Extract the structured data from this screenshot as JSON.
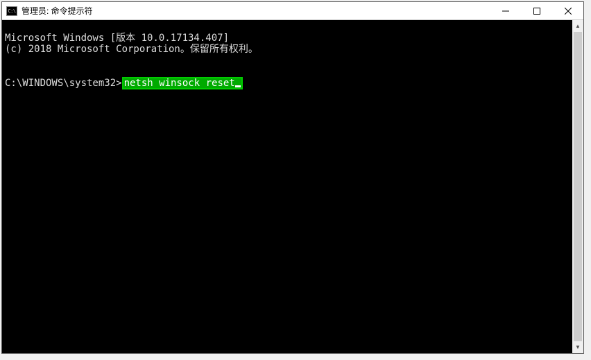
{
  "window": {
    "title": "管理员: 命令提示符",
    "icon_label": "C:\\"
  },
  "terminal": {
    "line1": "Microsoft Windows [版本 10.0.17134.407]",
    "line2": "(c) 2018 Microsoft Corporation。保留所有权利。",
    "prompt": "C:\\WINDOWS\\system32>",
    "command": "netsh winsock reset"
  }
}
